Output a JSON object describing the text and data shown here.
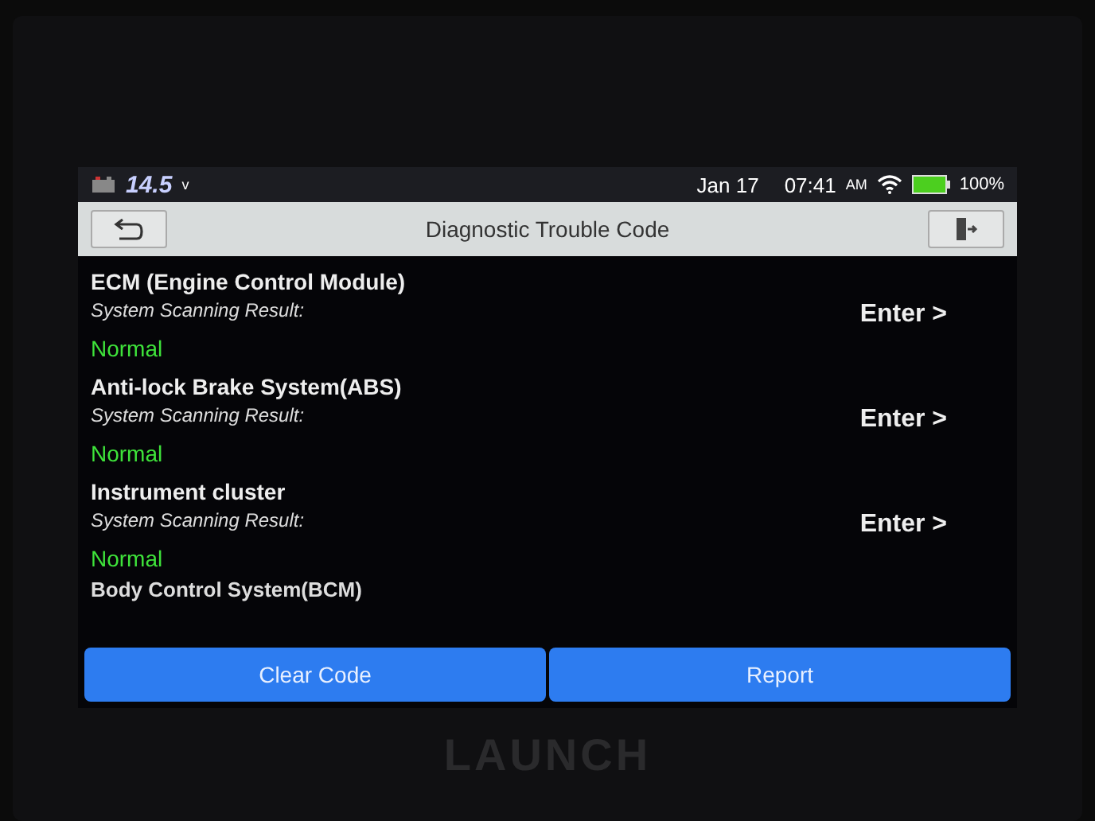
{
  "status_bar": {
    "voltage": "14.5",
    "voltage_unit": "v",
    "date": "Jan 17",
    "time": "07:41",
    "meridiem": "AM",
    "battery": "100%"
  },
  "title_bar": {
    "title": "Diagnostic Trouble Code"
  },
  "systems": [
    {
      "name": "ECM (Engine Control Module)",
      "result_label": "System Scanning Result:",
      "result": "Normal",
      "action": "Enter >"
    },
    {
      "name": "Anti-lock Brake System(ABS)",
      "result_label": "System Scanning Result:",
      "result": "Normal",
      "action": "Enter >"
    },
    {
      "name": "Instrument cluster",
      "result_label": "System Scanning Result:",
      "result": "Normal",
      "action": "Enter >"
    }
  ],
  "partial_row": {
    "name": "Body Control System(BCM)"
  },
  "buttons": [
    "Clear Code",
    "Report"
  ],
  "device": {
    "brand": "LAUNCH"
  }
}
